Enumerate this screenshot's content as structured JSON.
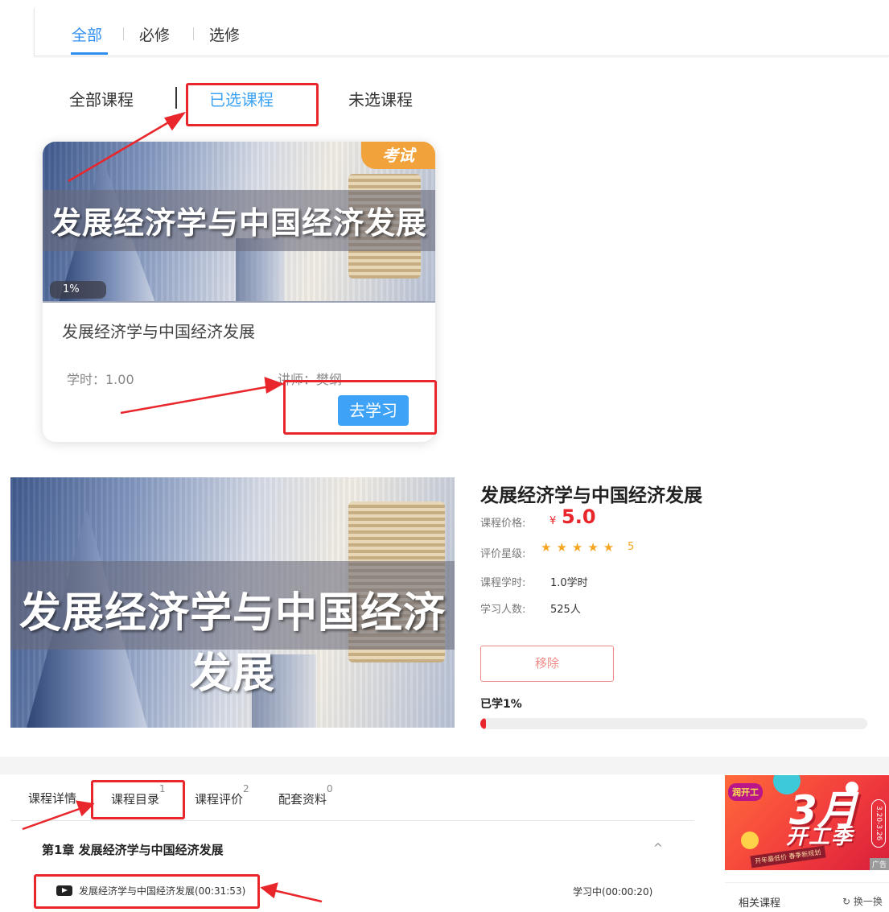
{
  "category_tabs": [
    "全部",
    "必修",
    "选修"
  ],
  "filter_tabs": [
    "全部课程",
    "已选课程",
    "未选课程"
  ],
  "card": {
    "cover_title": "发展经济学与中国经济发展",
    "badge": "考试",
    "progress": "1%",
    "name": "发展经济学与中国经济发展",
    "hours": "学时：1.00",
    "teacher": "讲师：樊纲",
    "button": "去学习"
  },
  "detail": {
    "cover_title": "发展经济学与中国经济发展",
    "title": "发展经济学与中国经济发展",
    "price_label": "课程价格:",
    "price_symbol": "¥",
    "price": "5.0",
    "rating_label": "评价星级:",
    "stars": "★★★★★",
    "rating": "5",
    "rating_value": 5,
    "hours_label": "课程学时:",
    "hours": "1.0学时",
    "learners_label": "学习人数:",
    "learners": "525人",
    "remove_button": "移除",
    "learned": "已学1%",
    "learned_fraction": 0.01
  },
  "detail_tabs": [
    {
      "label": "课程详情",
      "count": ""
    },
    {
      "label": "课程目录",
      "count": "1"
    },
    {
      "label": "课程评价",
      "count": "2"
    },
    {
      "label": "配套资料",
      "count": "0"
    }
  ],
  "catalog": {
    "chapter": "第1章  发展经济学与中国经济发展",
    "chevron": "^",
    "lesson_title": "发展经济学与中国经济发展(00:31:53)",
    "lesson_status": "学习中(00:00:20)"
  },
  "sidebar": {
    "ad_logo": "润开工",
    "ad_big": "3月",
    "ad_word": "开工季",
    "ad_strip": "开年最低价 春季新规划",
    "ad_date": "3.20-3.26",
    "ad_tag": "广告",
    "related_title": "相关课程",
    "refresh_label": "换一换"
  },
  "colors": {
    "accent_blue": "#2f8ff0",
    "price_red": "#e8262b",
    "star_orange": "#f5a623",
    "annotation_red": "#e8262b"
  }
}
